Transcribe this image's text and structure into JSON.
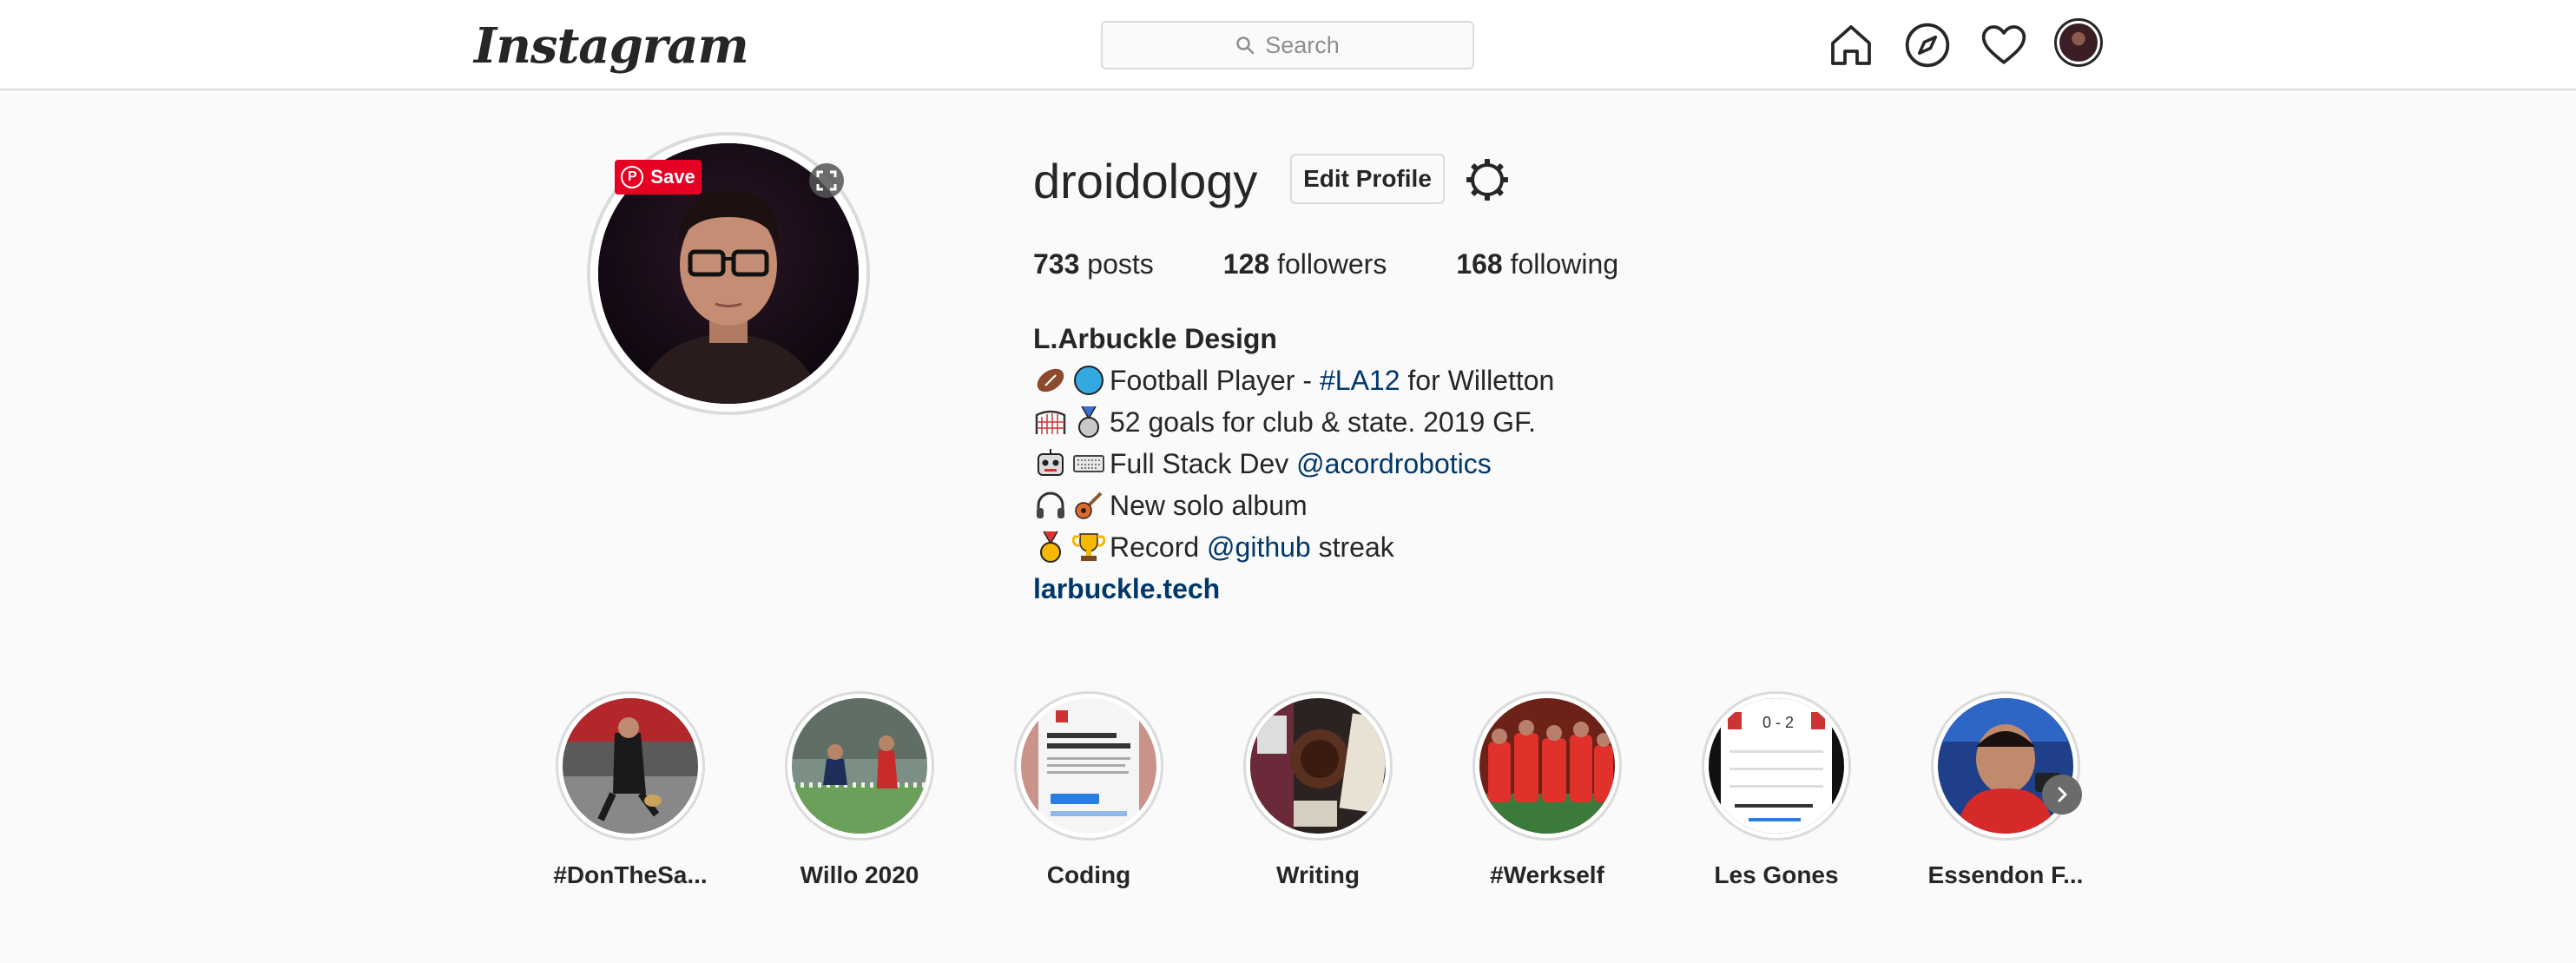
{
  "nav": {
    "logo_text": "Instagram",
    "search_placeholder": "Search",
    "icons": [
      "home-icon",
      "explore-icon",
      "activity-heart-icon",
      "profile-avatar"
    ]
  },
  "profile": {
    "username": "droidology",
    "edit_profile_label": "Edit Profile",
    "pinterest_save_label": "Save",
    "stats": [
      {
        "count": "733",
        "label": "posts"
      },
      {
        "count": "128",
        "label": "followers"
      },
      {
        "count": "168",
        "label": "following"
      }
    ],
    "bio": {
      "name": "L.Arbuckle Design",
      "line1": {
        "emoji": [
          "football-emoji",
          "blue-circle-emoji"
        ],
        "text_before": "Football Player - ",
        "hashtag": "#LA12",
        "text_after": " for Willetton"
      },
      "line2": {
        "emoji": [
          "goal-net-emoji",
          "medal-emoji"
        ],
        "text": "52 goals for club & state. 2019 GF."
      },
      "line3": {
        "emoji": [
          "robot-emoji",
          "keyboard-emoji"
        ],
        "text_before": "Full Stack Dev ",
        "mention": "@acordrobotics"
      },
      "line4": {
        "emoji": [
          "headphones-emoji",
          "guitar-emoji"
        ],
        "text": "New solo album"
      },
      "line5": {
        "emoji": [
          "gold-medal-emoji",
          "trophy-emoji"
        ],
        "text_before": "Record ",
        "mention": "@github",
        "text_after": " streak"
      },
      "website": "larbuckle.tech"
    }
  },
  "highlights": [
    {
      "label": "#DonTheSa..."
    },
    {
      "label": "Willo 2020"
    },
    {
      "label": "Coding"
    },
    {
      "label": "Writing"
    },
    {
      "label": "#Werkself"
    },
    {
      "label": "Les Gones"
    },
    {
      "label": "Essendon F..."
    }
  ],
  "colors": {
    "link": "#00376b",
    "pinterest": "#e60023",
    "border": "#dbdbdb",
    "background": "#fafafa"
  }
}
